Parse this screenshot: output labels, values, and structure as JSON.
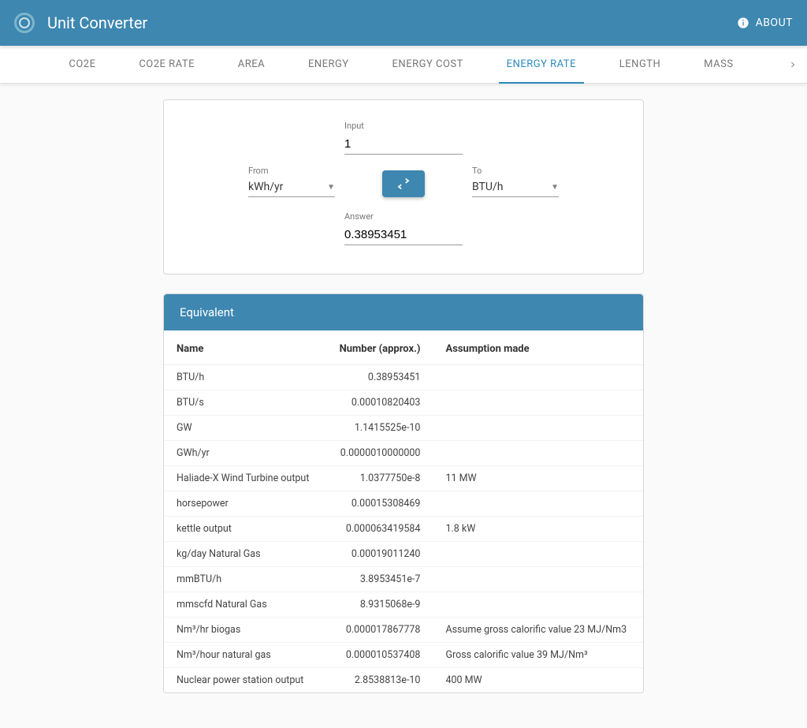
{
  "header": {
    "title": "Unit Converter",
    "about_label": "ABOUT"
  },
  "tabs": {
    "items": [
      {
        "label": "CO2E",
        "active": false
      },
      {
        "label": "CO2E RATE",
        "active": false
      },
      {
        "label": "AREA",
        "active": false
      },
      {
        "label": "ENERGY",
        "active": false
      },
      {
        "label": "ENERGY COST",
        "active": false
      },
      {
        "label": "ENERGY RATE",
        "active": true
      },
      {
        "label": "LENGTH",
        "active": false
      },
      {
        "label": "MASS",
        "active": false
      }
    ]
  },
  "converter": {
    "input_label": "Input",
    "input_value": "1",
    "from_label": "From",
    "from_value": "kWh/yr",
    "to_label": "To",
    "to_value": "BTU/h",
    "answer_label": "Answer",
    "answer_value": "0.38953451"
  },
  "equivalent": {
    "header": "Equivalent",
    "columns": {
      "name": "Name",
      "number": "Number (approx.)",
      "assumption": "Assumption made"
    },
    "rows": [
      {
        "name": "BTU/h",
        "number": "0.38953451",
        "assumption": ""
      },
      {
        "name": "BTU/s",
        "number": "0.00010820403",
        "assumption": ""
      },
      {
        "name": "GW",
        "number": "1.1415525e-10",
        "assumption": ""
      },
      {
        "name": "GWh/yr",
        "number": "0.0000010000000",
        "assumption": ""
      },
      {
        "name": "Haliade-X Wind Turbine output",
        "number": "1.0377750e-8",
        "assumption": "11 MW"
      },
      {
        "name": "horsepower",
        "number": "0.00015308469",
        "assumption": ""
      },
      {
        "name": "kettle output",
        "number": "0.000063419584",
        "assumption": "1.8 kW"
      },
      {
        "name": "kg/day Natural Gas",
        "number": "0.00019011240",
        "assumption": ""
      },
      {
        "name": "mmBTU/h",
        "number": "3.8953451e-7",
        "assumption": ""
      },
      {
        "name": "mmscfd Natural Gas",
        "number": "8.9315068e-9",
        "assumption": ""
      },
      {
        "name": "Nm³/hr biogas",
        "number": "0.000017867778",
        "assumption": "Assume gross calorific value 23 MJ/Nm3"
      },
      {
        "name": "Nm³/hour natural gas",
        "number": "0.000010537408",
        "assumption": "Gross calorific value 39 MJ/Nm³"
      },
      {
        "name": "Nuclear power station output",
        "number": "2.8538813e-10",
        "assumption": "400 MW"
      }
    ]
  }
}
